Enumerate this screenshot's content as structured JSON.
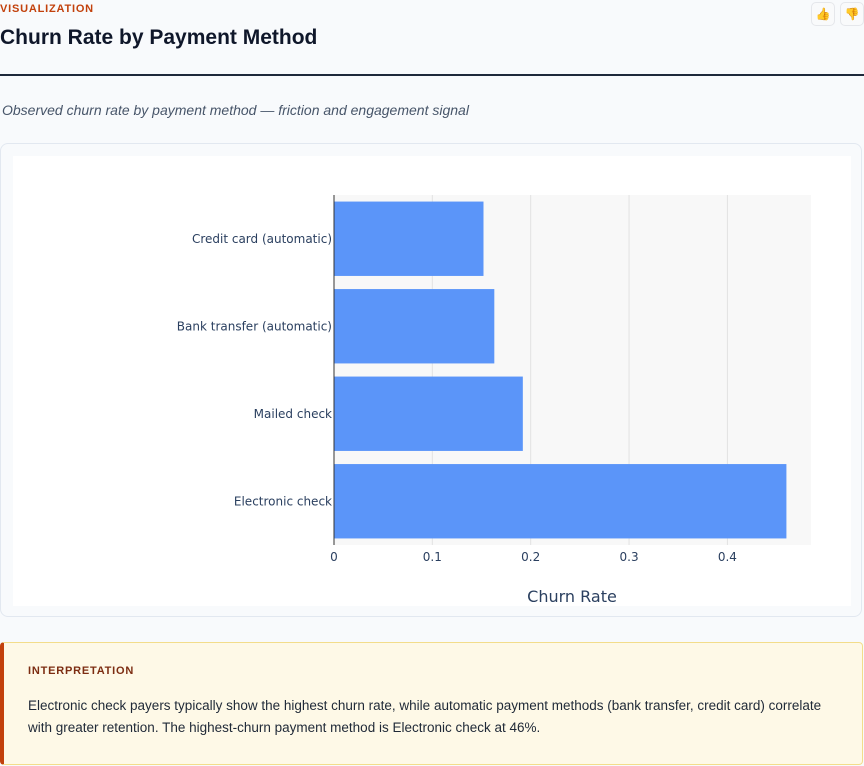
{
  "header": {
    "eyebrow": "VISUALIZATION",
    "title": "Churn Rate by Payment Method",
    "feedback": {
      "up_icon": "thumbs-up-icon",
      "down_icon": "thumbs-down-icon"
    }
  },
  "subtitle": "Observed churn rate by payment method — friction and engagement signal",
  "chart_data": {
    "type": "bar",
    "orientation": "horizontal",
    "categories": [
      "Credit card (automatic)",
      "Bank transfer (automatic)",
      "Mailed check",
      "Electronic check"
    ],
    "values": [
      0.152,
      0.163,
      0.192,
      0.46
    ],
    "xlabel": "Churn Rate",
    "ylabel": "",
    "xlim": [
      0,
      0.485
    ],
    "xticks": [
      0,
      0.1,
      0.2,
      0.3,
      0.4
    ],
    "xtick_labels": [
      "0",
      "0.1",
      "0.2",
      "0.3",
      "0.4"
    ],
    "grid": true,
    "bar_color": "#5b95f9",
    "plot_bg": "#f8f8f8"
  },
  "interpretation": {
    "label": "INTERPRETATION",
    "text": "Electronic check payers typically show the highest churn rate, while automatic payment methods (bank transfer, credit card) correlate with greater retention. The highest-churn payment method is Electronic check at 46%."
  },
  "colors": {
    "accent": "#c2410c",
    "callout_bg": "#fef9e7"
  }
}
